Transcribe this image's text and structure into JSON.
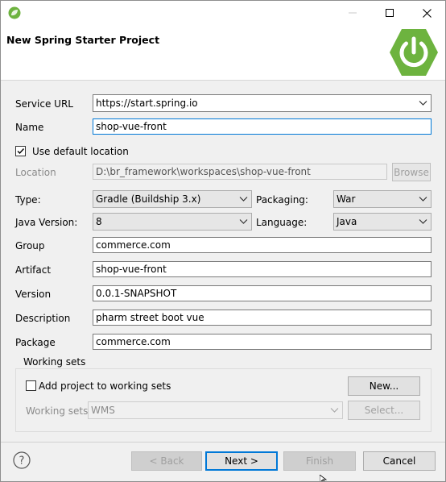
{
  "window": {
    "icon": "spring-leaf-icon",
    "controls": {
      "minimize": "–",
      "maximize": "☐",
      "close": "✕"
    }
  },
  "banner": {
    "title": "New Spring Starter Project",
    "logo": "spring-power-logo",
    "logo_color": "#6db33f"
  },
  "form": {
    "service_url": {
      "label": "Service URL",
      "value": "https://start.spring.io"
    },
    "name": {
      "label": "Name",
      "value": "shop-vue-front"
    },
    "use_default_location": {
      "label": "Use default location",
      "checked": true
    },
    "location": {
      "label": "Location",
      "value": "D:\\br_framework\\workspaces\\shop-vue-front",
      "browse": "Browse"
    },
    "type": {
      "label": "Type:",
      "value": "Gradle (Buildship 3.x)"
    },
    "packaging": {
      "label": "Packaging:",
      "value": "War"
    },
    "java_version": {
      "label": "Java Version:",
      "value": "8"
    },
    "language": {
      "label": "Language:",
      "value": "Java"
    },
    "group": {
      "label": "Group",
      "value": "commerce.com"
    },
    "artifact": {
      "label": "Artifact",
      "value": "shop-vue-front"
    },
    "version": {
      "label": "Version",
      "value": "0.0.1-SNAPSHOT"
    },
    "description": {
      "label": "Description",
      "value": "pharm street boot vue"
    },
    "package": {
      "label": "Package",
      "value": "commerce.com"
    }
  },
  "working_sets": {
    "title": "Working sets",
    "add_label": "Add project to working sets",
    "add_checked": false,
    "new_button": "New...",
    "sets_label": "Working sets:",
    "sets_value": "WMS",
    "select_button": "Select..."
  },
  "footer": {
    "help": "?",
    "back": "< Back",
    "next": "Next >",
    "finish": "Finish",
    "cancel": "Cancel"
  }
}
